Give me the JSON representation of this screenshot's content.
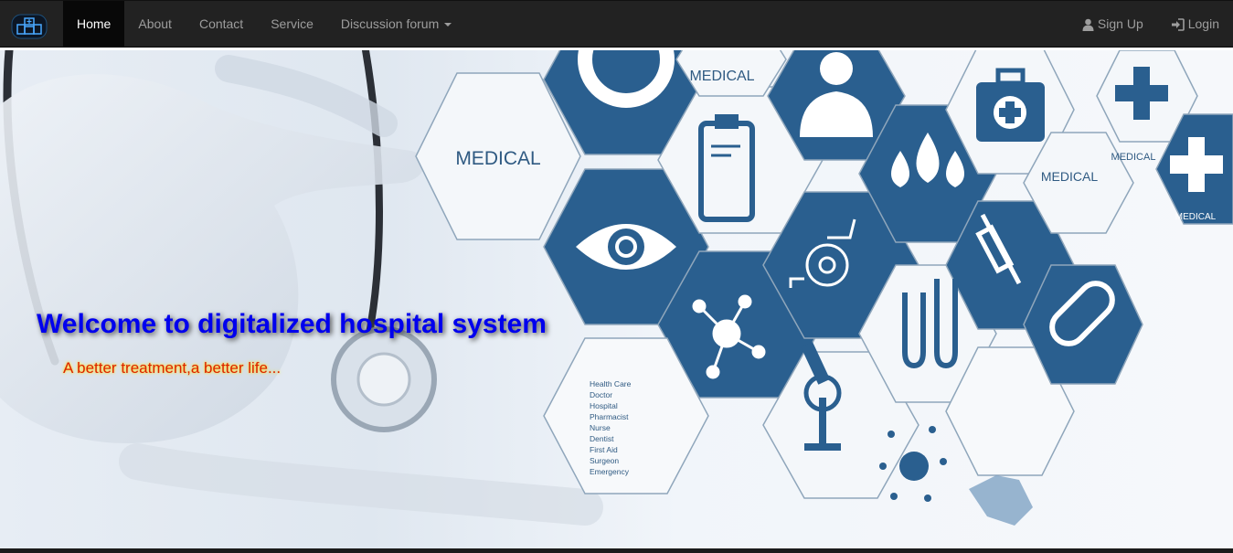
{
  "navbar": {
    "brand_icon": "hospital-logo-icon",
    "left_items": [
      {
        "label": "Home",
        "active": true
      },
      {
        "label": "About",
        "active": false
      },
      {
        "label": "Contact",
        "active": false
      },
      {
        "label": "Service",
        "active": false
      },
      {
        "label": "Discussion forum",
        "active": false,
        "dropdown": true
      }
    ],
    "right_items": [
      {
        "label": "Sign Up",
        "icon": "user-icon"
      },
      {
        "label": "Login",
        "icon": "login-icon"
      }
    ]
  },
  "hero": {
    "title": "Welcome to digitalized hospital system",
    "tagline": "A better treatment,a better life...",
    "hex_labels": [
      "MEDICAL",
      "MEDICAL",
      "MEDICAL",
      "MEDICAL",
      "MEDICAL"
    ],
    "hex_list": [
      "Health Care",
      "Doctor",
      "Hospital",
      "Pharmacist",
      "Nurse",
      "Dentist",
      "First Aid",
      "Surgeon",
      "Emergency"
    ]
  },
  "colors": {
    "navbar_bg": "#222222",
    "nav_active_bg": "#080808",
    "nav_text": "#9d9d9d",
    "hex_blue": "#2a5f8f",
    "title_color": "#0000ee",
    "tagline_color": "#dd2200"
  }
}
